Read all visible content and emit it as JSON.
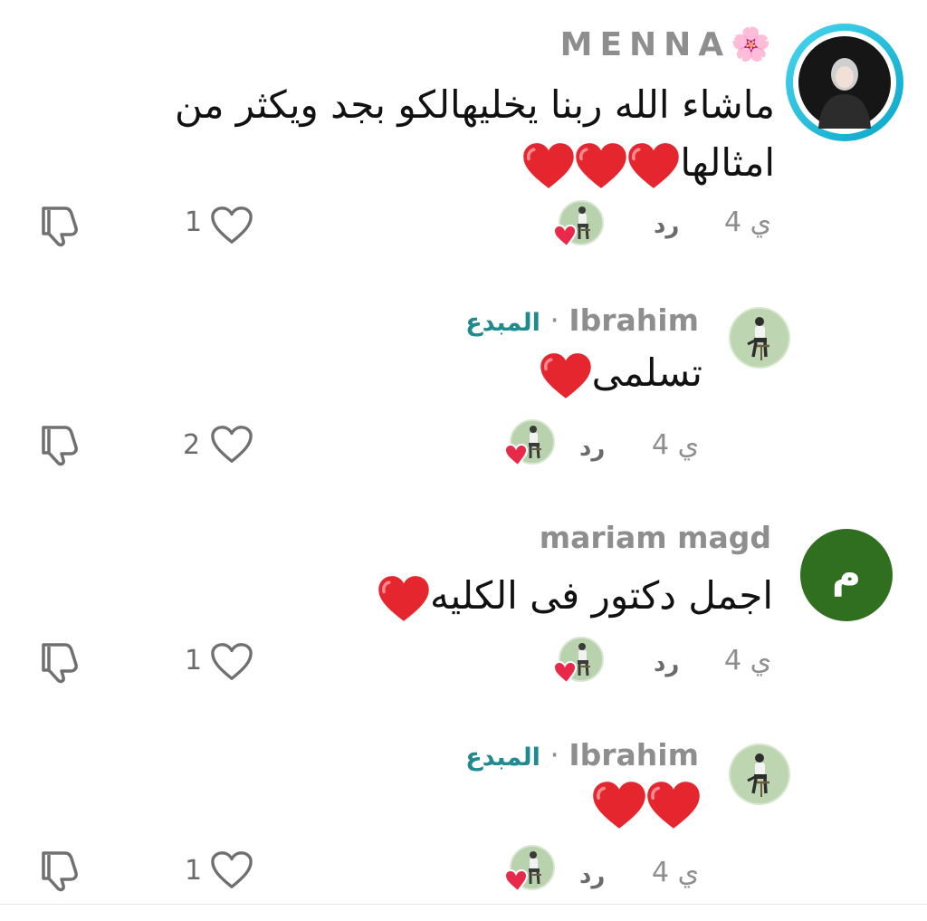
{
  "comments": [
    {
      "username": "MENNA",
      "flower": "🌸",
      "text_line1": "ماشاء الله ربنا يخليهالكو بجد ويكثر من",
      "text_line2": "امثالها",
      "time": "4 ي",
      "reply_label": "رد",
      "likes": "1"
    },
    {
      "username": "Ibrahim",
      "separator": "·",
      "badge": "المبدع",
      "text": "تسلمى",
      "time": "4 ي",
      "reply_label": "رد",
      "likes": "2"
    },
    {
      "username": "mariam magd",
      "avatar_letter": "م",
      "text": "اجمل دكتور فى الكليه",
      "time": "4 ي",
      "reply_label": "رد",
      "likes": "1"
    },
    {
      "username": "Ibrahim",
      "separator": "·",
      "badge": "المبدع",
      "time": "4 ي",
      "reply_label": "رد",
      "likes": "1"
    }
  ],
  "colors": {
    "heart": "#e5262f",
    "ring_gradient": [
      "#2ec8e8",
      "#0aa6c9"
    ],
    "avatar_green": "#2f6f1f",
    "badge": "#1f8a8f"
  },
  "icons": [
    "heart-icon",
    "dislike-icon",
    "creator-liked-badge"
  ]
}
